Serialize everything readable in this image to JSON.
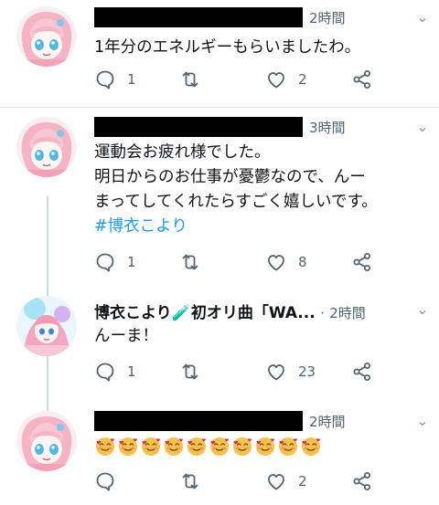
{
  "tweets": [
    {
      "time": "2時間",
      "menu": "⌄",
      "lines": [
        "1年分のエネルギーもらいましたわ。"
      ],
      "reply_count": "1",
      "retweet_count": "",
      "like_count": "2",
      "icons": [
        "reply-icon",
        "retweet-icon",
        "like-icon",
        "share-icon"
      ]
    },
    {
      "time": "3時間",
      "menu": "⌄",
      "lines": [
        "運動会お疲れ様でした。",
        "明日からのお仕事が憂鬱なので、んー",
        "まってしてくれたらすごく嬉しいです。"
      ],
      "hashtag": "#博衣こより",
      "reply_count": "1",
      "retweet_count": "",
      "like_count": "8"
    },
    {
      "display_name": "博衣こより🧪初オリ曲「WA...",
      "separator": "·",
      "time": "2時間",
      "menu": "⌄",
      "lines": [
        "んーま！"
      ],
      "reply_count": "1",
      "retweet_count": "",
      "like_count": "23"
    },
    {
      "time": "2時間",
      "menu": "⌄",
      "emoji": "🥰",
      "emoji_count": 10,
      "reply_count": "",
      "retweet_count": "",
      "like_count": "2"
    }
  ],
  "colors": {
    "text": "#0f1419",
    "secondary": "#536471",
    "hashtag": "#1d9bf0",
    "divider": "#e6ecf0",
    "thread_line": "#cfd9de"
  }
}
